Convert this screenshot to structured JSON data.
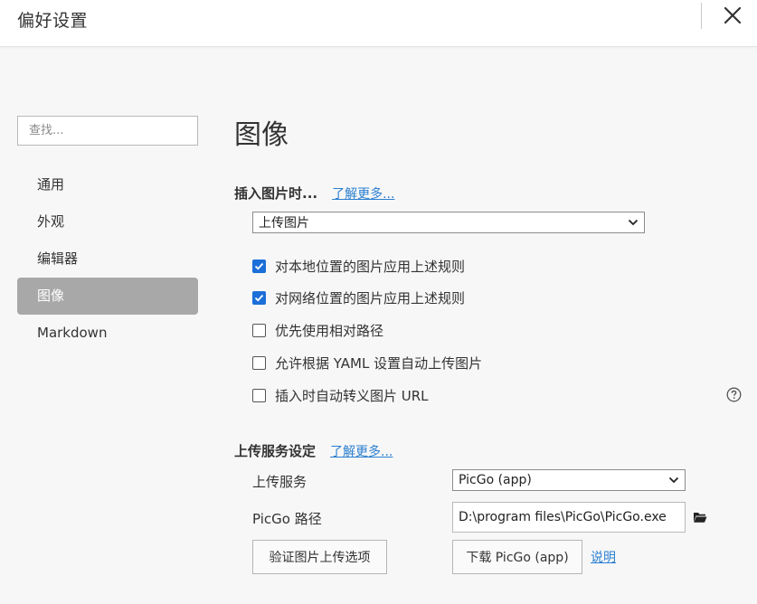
{
  "window": {
    "title": "偏好设置"
  },
  "sidebar": {
    "search_placeholder": "查找...",
    "items": [
      {
        "label": "通用"
      },
      {
        "label": "外观"
      },
      {
        "label": "编辑器"
      },
      {
        "label": "图像",
        "active": true
      },
      {
        "label": "Markdown"
      }
    ]
  },
  "main": {
    "page_title": "图像",
    "insert_section": {
      "heading": "插入图片时...",
      "learn_more": "了解更多...",
      "action_select": "上传图片",
      "options": [
        {
          "label": "对本地位置的图片应用上述规则",
          "checked": true
        },
        {
          "label": "对网络位置的图片应用上述规则",
          "checked": true
        },
        {
          "label": "优先使用相对路径",
          "checked": false
        },
        {
          "label": "允许根据 YAML 设置自动上传图片",
          "checked": false
        },
        {
          "label": "插入时自动转义图片 URL",
          "checked": false
        }
      ]
    },
    "upload_section": {
      "heading": "上传服务设定",
      "learn_more": "了解更多...",
      "service_label": "上传服务",
      "service_value": "PicGo (app)",
      "path_label": "PicGo 路径",
      "path_value": "D:\\program files\\PicGo\\PicGo.exe",
      "verify_button": "验证图片上传选项",
      "download_button": "下载 PicGo (app)",
      "help_link": "说明"
    }
  },
  "colors": {
    "accent": "#1c6fd8",
    "link": "#2b7fd0",
    "active_nav": "#a8a8a8"
  }
}
